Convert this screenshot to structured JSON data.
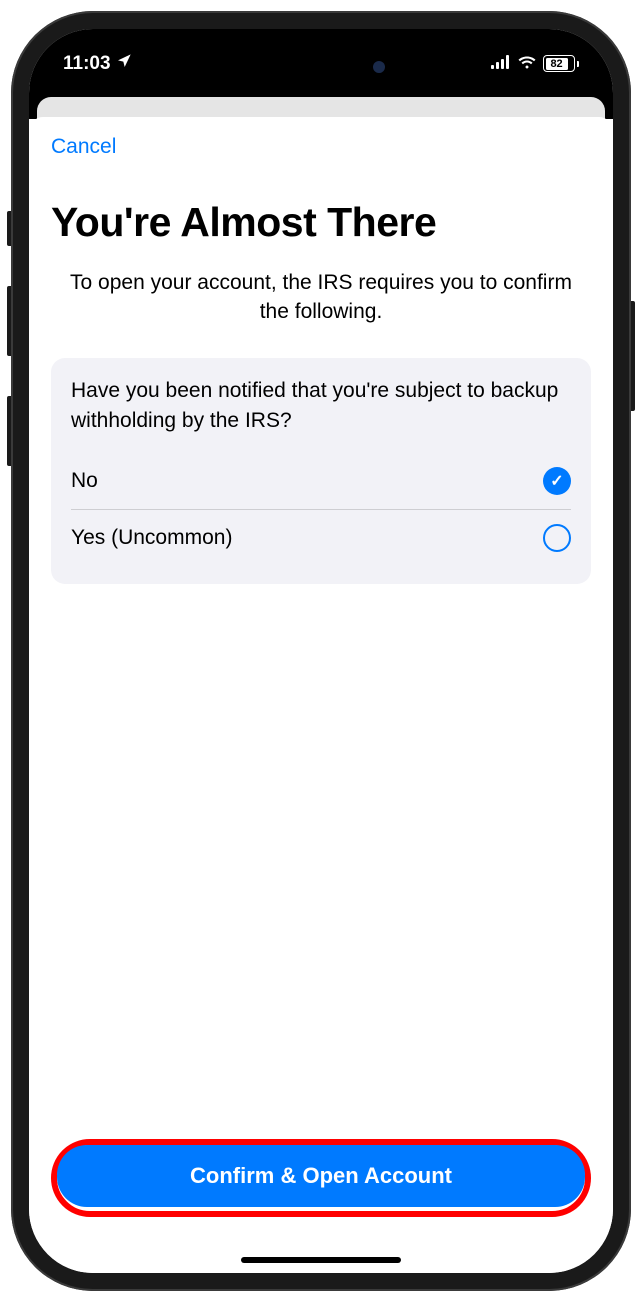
{
  "status_bar": {
    "time": "11:03",
    "battery_pct": "82"
  },
  "nav": {
    "cancel_label": "Cancel"
  },
  "page": {
    "title": "You're Almost There",
    "subtitle": "To open your account, the IRS requires you to confirm the following."
  },
  "question": {
    "text": "Have you been notified that you're subject to backup withholding by the IRS?",
    "options": [
      {
        "label": "No",
        "selected": true
      },
      {
        "label": "Yes (Uncommon)",
        "selected": false
      }
    ]
  },
  "cta": {
    "label": "Confirm & Open Account"
  }
}
